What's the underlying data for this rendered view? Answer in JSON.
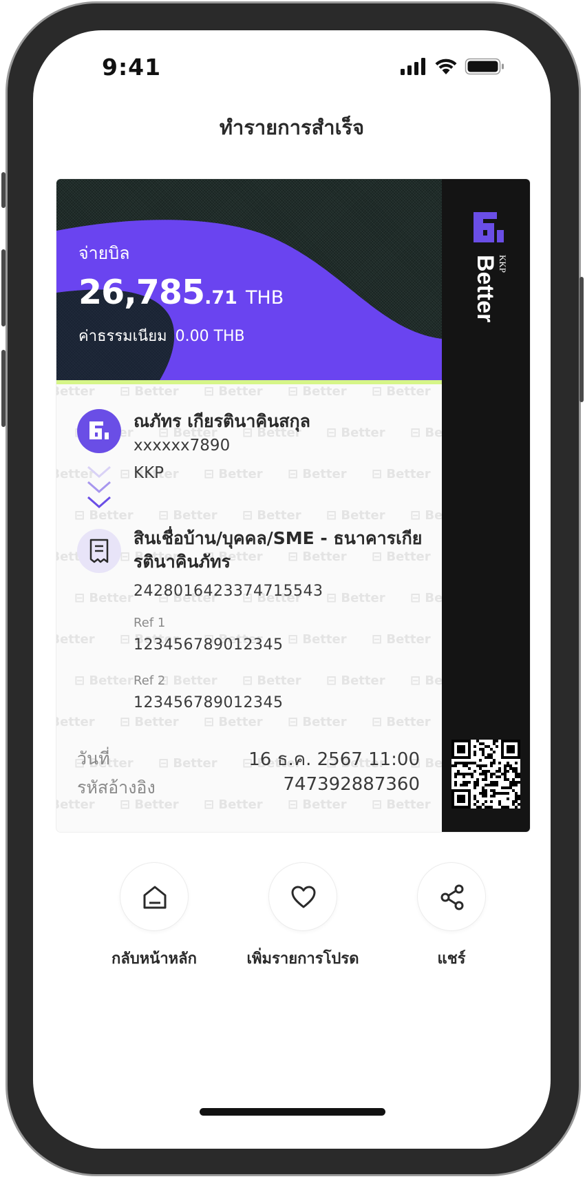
{
  "status_bar": {
    "time": "9:41"
  },
  "header": {
    "title": "ทำรายการสำเร็จ"
  },
  "receipt": {
    "type_label": "จ่ายบิล",
    "amount_integer": "26,785",
    "amount_decimal": ".71",
    "currency": "THB",
    "fee_label": "ค่าธรรมเนียม",
    "fee_value": "0.00",
    "fee_currency": "THB",
    "from": {
      "name": "ณภัทร เกียรตินาคินสกุล",
      "account": "xxxxxx7890",
      "bank": "KKP"
    },
    "to": {
      "name": "สินเชื่อบ้าน/บุคคล/SME - ธนาคารเกียรตินาคินภัทร",
      "account": "2428016423374715543",
      "ref1_label": "Ref 1",
      "ref1_value": "12345678901234​5",
      "ref2_label": "Ref 2",
      "ref2_value": "12345678901234​5"
    },
    "date_label": "วันที่",
    "date_value": "16 ธ.ค. 2567 11:00",
    "ref_code_label": "รหัสอ้างอิง",
    "ref_code_value": "747392887360",
    "watermark_text": "Better",
    "brand_name": "Better",
    "brand_prefix": "KKP"
  },
  "actions": [
    {
      "label": "กลับหน้าหลัก",
      "icon": "home-icon"
    },
    {
      "label": "เพิ่มรายการโปรด",
      "icon": "heart-icon"
    },
    {
      "label": "แชร์",
      "icon": "share-icon"
    }
  ],
  "colors": {
    "accent_purple": "#6a4ee6",
    "accent_lime": "#d6f588",
    "side_panel": "#141414"
  }
}
